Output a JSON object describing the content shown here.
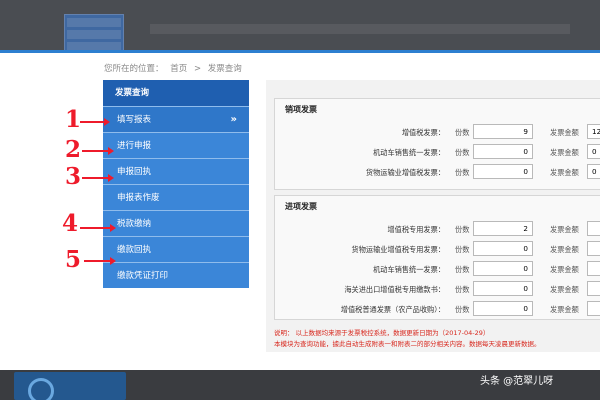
{
  "breadcrumb": {
    "prefix": "您所在的位置：",
    "home": "首页",
    "sep": ">",
    "current": "发票查询"
  },
  "sidebar": {
    "header": "发票查询",
    "items": [
      {
        "label": "填写报表",
        "chevron": "»"
      },
      {
        "label": "进行申报"
      },
      {
        "label": "申报回执"
      },
      {
        "label": "申报表作废"
      },
      {
        "label": "税款缴纳"
      },
      {
        "label": "缴款回执"
      },
      {
        "label": "缴款凭证打印"
      }
    ]
  },
  "sales": {
    "title": "销项发票",
    "rows": [
      {
        "label": "增值税发票：",
        "count_label": "份数",
        "count": "9",
        "amount_label": "发票金额",
        "amount": "12"
      },
      {
        "label": "机动车销售统一发票：",
        "count_label": "份数",
        "count": "0",
        "amount_label": "发票金额",
        "amount": "0"
      },
      {
        "label": "货物运输业增值税发票：",
        "count_label": "份数",
        "count": "0",
        "amount_label": "发票金额",
        "amount": "0"
      }
    ]
  },
  "purchase": {
    "title": "进项发票",
    "rows": [
      {
        "label": "增值税专用发票：",
        "count_label": "份数",
        "count": "2",
        "amount_label": "发票金额",
        "amount": ""
      },
      {
        "label": "货物运输业增值税专用发票：",
        "count_label": "份数",
        "count": "0",
        "amount_label": "发票金额",
        "amount": ""
      },
      {
        "label": "机动车销售统一发票：",
        "count_label": "份数",
        "count": "0",
        "amount_label": "发票金额",
        "amount": ""
      },
      {
        "label": "海关进出口增值税专用缴款书：",
        "count_label": "份数",
        "count": "0",
        "amount_label": "发票金额",
        "amount": ""
      },
      {
        "label": "增值税普通发票（农产品收购）：",
        "count_label": "份数",
        "count": "0",
        "amount_label": "发票金额",
        "amount": ""
      }
    ]
  },
  "note": {
    "line1": "说明： 以上数据均来源于发票税控系统，数据更新日期为（2017-04-29）",
    "line2": "本模块为查询功能，據此自动生成附表一和附表二的部分相关内容。数据每天凌晨更新数据。"
  },
  "annotations": [
    "1",
    "2",
    "3",
    "4",
    "5"
  ],
  "watermark": "头条 @范翠儿呀",
  "colors": {
    "sidebar_header": "#1f5fb0",
    "sidebar_item": "#3b86d8",
    "annotation": "#ee1b2b",
    "note": "#d8281e"
  }
}
